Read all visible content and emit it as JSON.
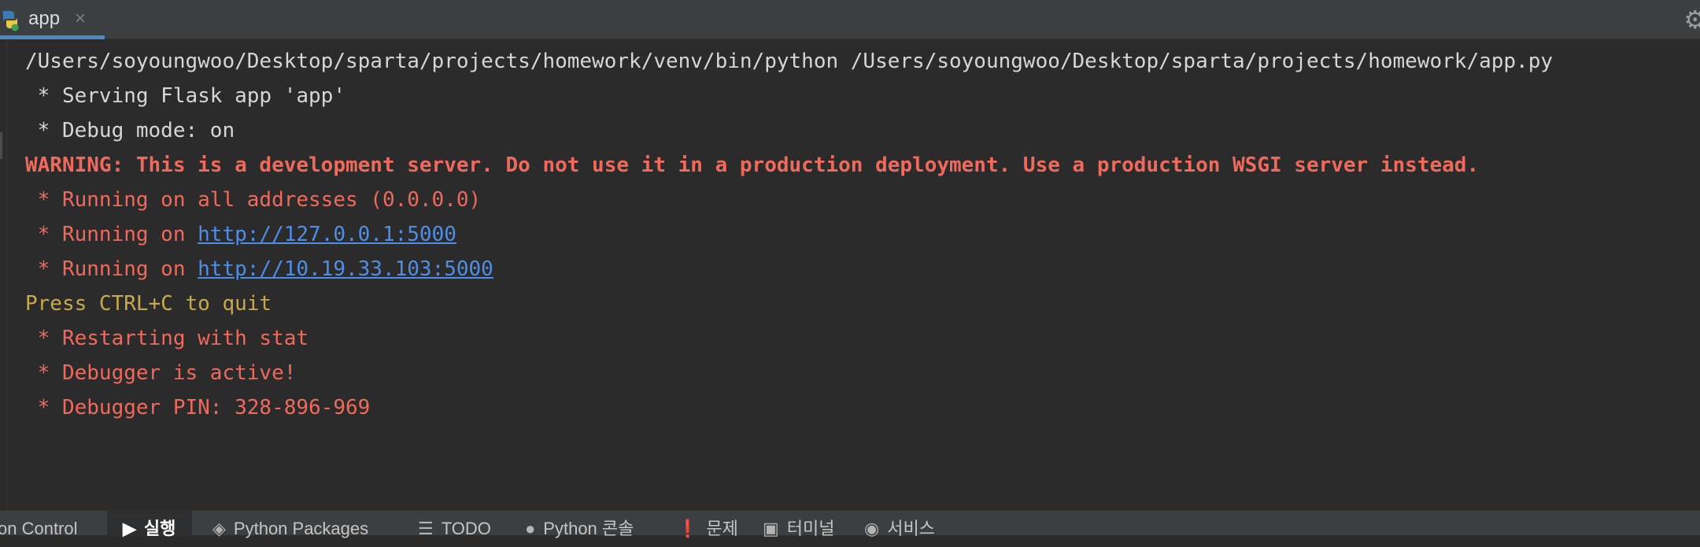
{
  "tab": {
    "label": "app",
    "close_symbol": "×"
  },
  "console": {
    "lines": [
      {
        "text": "/Users/soyoungwoo/Desktop/sparta/projects/homework/venv/bin/python /Users/soyoungwoo/Desktop/sparta/projects/homework/app.py"
      },
      {
        "text": " * Serving Flask app 'app'"
      },
      {
        "text": " * Debug mode: on"
      },
      {
        "text": "WARNING: This is a development server. Do not use it in a production deployment. Use a production WSGI server instead."
      },
      {
        "text": " * Running on all addresses (0.0.0.0)"
      },
      {
        "prefix": " * Running on ",
        "link": "http://127.0.0.1:5000"
      },
      {
        "prefix": " * Running on ",
        "link": "http://10.19.33.103:5000"
      },
      {
        "text": "Press CTRL+C to quit"
      },
      {
        "text": " * Restarting with stat"
      },
      {
        "text": " * Debugger is active!"
      },
      {
        "text": " * Debugger PIN: 328-896-969"
      }
    ]
  },
  "bottom_bar": {
    "items": [
      {
        "label": "on Control",
        "icon": "none"
      },
      {
        "label": "실행",
        "icon": "run-icon"
      },
      {
        "label": "Python Packages",
        "icon": "layers-icon"
      },
      {
        "label": "TODO",
        "icon": "list-icon"
      },
      {
        "label": "Python 콘솔",
        "icon": "python-icon"
      },
      {
        "label": "문제",
        "icon": "warning-icon"
      },
      {
        "label": "터미널",
        "icon": "terminal-icon"
      },
      {
        "label": "서비스",
        "icon": "services-icon"
      }
    ]
  },
  "colors": {
    "background": "#2b2b2b",
    "default_text": "#d6d6d6",
    "error_text": "#ef6a5c",
    "prompt_text": "#c8a94c",
    "link": "#4f8ee6",
    "tab_underline": "#4a88c7"
  }
}
